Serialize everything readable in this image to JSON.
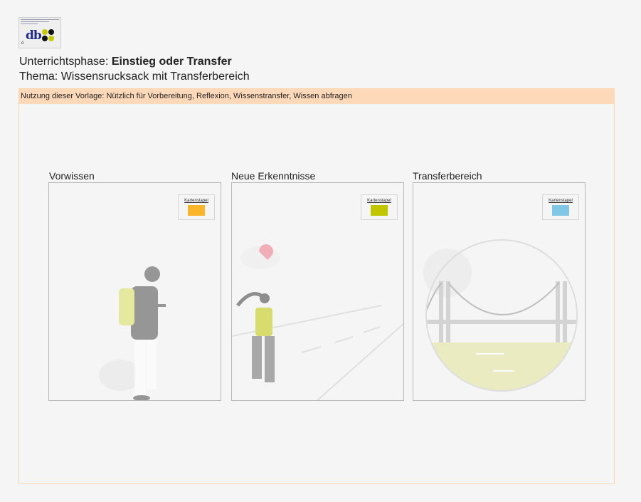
{
  "logo": {
    "text": "db",
    "caption": "ö",
    "dot_colors": [
      "#c8c800",
      "#111111",
      "#111111",
      "#c8c800"
    ]
  },
  "header": {
    "phase_label": "Unterrichtsphase: ",
    "phase_value": "Einstieg oder Transfer",
    "topic": "Thema: Wissensrucksack mit Transferbereich"
  },
  "banner": {
    "text": "Nutzung dieser Vorlage: Nützlich für Vorbereitung, Reflexion, Wissenstransfer, Wissen abfragen"
  },
  "panels": [
    {
      "title": "Vorwissen",
      "stack_label": "Kartenstapel",
      "card_color": "#fbb52a",
      "illustration": "person-with-backpack"
    },
    {
      "title": "Neue Erkenntnisse",
      "stack_label": "Kartenstapel",
      "card_color": "#c2c600",
      "illustration": "person-on-road"
    },
    {
      "title": "Transferbereich",
      "stack_label": "Kartenstapel",
      "card_color": "#7fc7e4",
      "illustration": "bridge"
    }
  ],
  "colors": {
    "banner": "#fdd8b9",
    "frame_border": "#fbd4b0",
    "background": "#f5f5f5"
  }
}
